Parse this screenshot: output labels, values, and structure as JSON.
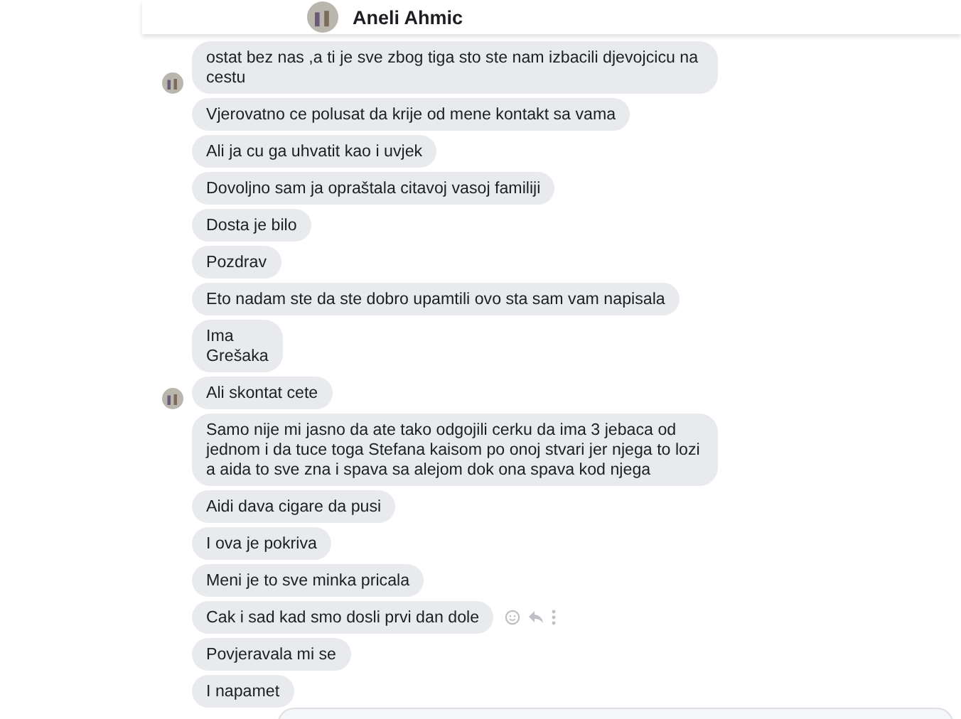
{
  "header": {
    "name": "Aneli Ahmic"
  },
  "messages": [
    {
      "text": "ostat bez nas ,a ti je sve zbog tiga sto ste nam izbacili djevojcicu na cestu",
      "avatar": true,
      "actions": false
    },
    {
      "text": "Vjerovatno ce polusat da krije od mene kontakt sa vama",
      "avatar": false,
      "actions": false
    },
    {
      "text": "Ali ja cu ga uhvatit kao i uvjek",
      "avatar": false,
      "actions": false
    },
    {
      "text": "Dovoljno sam ja opraštala citavoj vasoj familiji",
      "avatar": false,
      "actions": false
    },
    {
      "text": "Dosta je bilo",
      "avatar": false,
      "actions": false
    },
    {
      "text": "Pozdrav",
      "avatar": false,
      "actions": false
    },
    {
      "text": "Eto nadam ste da ste dobro upamtili ovo sta sam vam napisala",
      "avatar": false,
      "actions": false
    },
    {
      "text": "Ima\nGrešaka",
      "avatar": false,
      "actions": false
    },
    {
      "text": "Ali skontat cete",
      "avatar": true,
      "actions": false
    },
    {
      "text": "Samo nije mi jasno da ate tako odgojili cerku da ima 3 jebaca od jednom i da tuce toga Stefana kaisom po onoj stvari jer njega to lozi a aida to sve zna i spava sa alejom dok ona spava kod njega",
      "avatar": false,
      "actions": false
    },
    {
      "text": "Aidi dava cigare da pusi",
      "avatar": false,
      "actions": false
    },
    {
      "text": "I ova je pokriva",
      "avatar": false,
      "actions": false
    },
    {
      "text": "Meni je to sve minka pricala",
      "avatar": false,
      "actions": false
    },
    {
      "text": "Cak i sad kad smo dosli prvi dan dole",
      "avatar": false,
      "actions": true
    },
    {
      "text": "Povjeravala mi se",
      "avatar": false,
      "actions": false
    },
    {
      "text": "I napamet",
      "avatar": false,
      "actions": false
    }
  ]
}
